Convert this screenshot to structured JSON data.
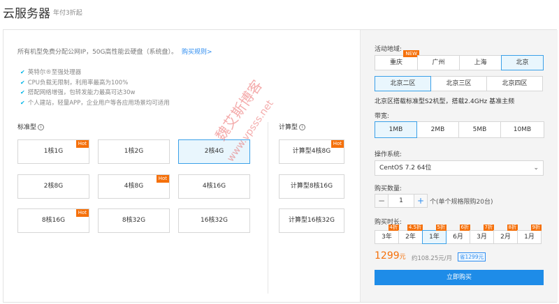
{
  "header": {
    "title": "云服务器",
    "subtitle": "年付3折起"
  },
  "left": {
    "description": "所有机型免费分配公网IP，50G高性能云硬盘（系统盘）。",
    "rules_link": "购买规则>",
    "features": [
      "英特尔®至强处理器",
      "CPU负载无限制，利用率最高为100%",
      "搭配网络增强，包转发能力最高可达30w",
      "个人建站，轻量APP，企业用户等各应用场景均可适用"
    ],
    "standard_label": "标准型",
    "compute_label": "计算型",
    "info_glyph": "i",
    "hot_label": "Hot",
    "standard_cards": [
      {
        "label": "1核1G",
        "hot": true,
        "selected": false
      },
      {
        "label": "1核2G",
        "hot": false,
        "selected": false
      },
      {
        "label": "2核4G",
        "hot": false,
        "selected": true
      },
      {
        "label": "2核8G",
        "hot": false,
        "selected": false
      },
      {
        "label": "4核8G",
        "hot": true,
        "selected": false
      },
      {
        "label": "4核16G",
        "hot": false,
        "selected": false
      },
      {
        "label": "8核16G",
        "hot": true,
        "selected": false
      },
      {
        "label": "8核32G",
        "hot": false,
        "selected": false
      },
      {
        "label": "16核32G",
        "hot": false,
        "selected": false
      }
    ],
    "compute_cards": [
      {
        "label": "计算型4核8G",
        "hot": true
      },
      {
        "label": "计算型8核16G",
        "hot": false
      },
      {
        "label": "计算型16核32G",
        "hot": false
      }
    ]
  },
  "right": {
    "region_label": "活动地域:",
    "regions": [
      {
        "label": "重庆",
        "tag": "NEW"
      },
      {
        "label": "广州"
      },
      {
        "label": "上海"
      },
      {
        "label": "北京",
        "selected": true
      }
    ],
    "zones": [
      {
        "label": "北京二区",
        "selected": true
      },
      {
        "label": "北京三区"
      },
      {
        "label": "北京四区"
      }
    ],
    "zone_desc": "北京区搭载标准型S2机型，搭载2.4GHz 基准主频",
    "bandwidth_label": "带宽:",
    "bandwidths": [
      {
        "label": "1MB",
        "selected": true
      },
      {
        "label": "2MB"
      },
      {
        "label": "5MB"
      },
      {
        "label": "10MB"
      }
    ],
    "os_label": "操作系统:",
    "os_value": "CentOS 7.2 64位",
    "qty_label": "购买数量:",
    "qty_minus": "−",
    "qty_value": "1",
    "qty_plus": "+",
    "qty_note": "个(单个规格限购20台)",
    "duration_label": "购买时长:",
    "durations": [
      {
        "label": "3年",
        "tag": "4折"
      },
      {
        "label": "2年",
        "tag": "4.5折"
      },
      {
        "label": "1年",
        "tag": "5折",
        "selected": true
      },
      {
        "label": "6月",
        "tag": "6折"
      },
      {
        "label": "3月",
        "tag": "7折"
      },
      {
        "label": "2月",
        "tag": "8折"
      },
      {
        "label": "1月",
        "tag": "9折"
      }
    ],
    "price": "1299",
    "price_unit": "元",
    "monthly": "约108.25元/月",
    "save": "省1299元",
    "buy_label": "立即购买"
  },
  "watermark": {
    "line1": "魏艾斯博客",
    "line2": "www.vpsss.net"
  },
  "colors": {
    "accent": "#1e8ce8",
    "hot": "#f5700a",
    "selected_border": "#3aa0e8"
  }
}
